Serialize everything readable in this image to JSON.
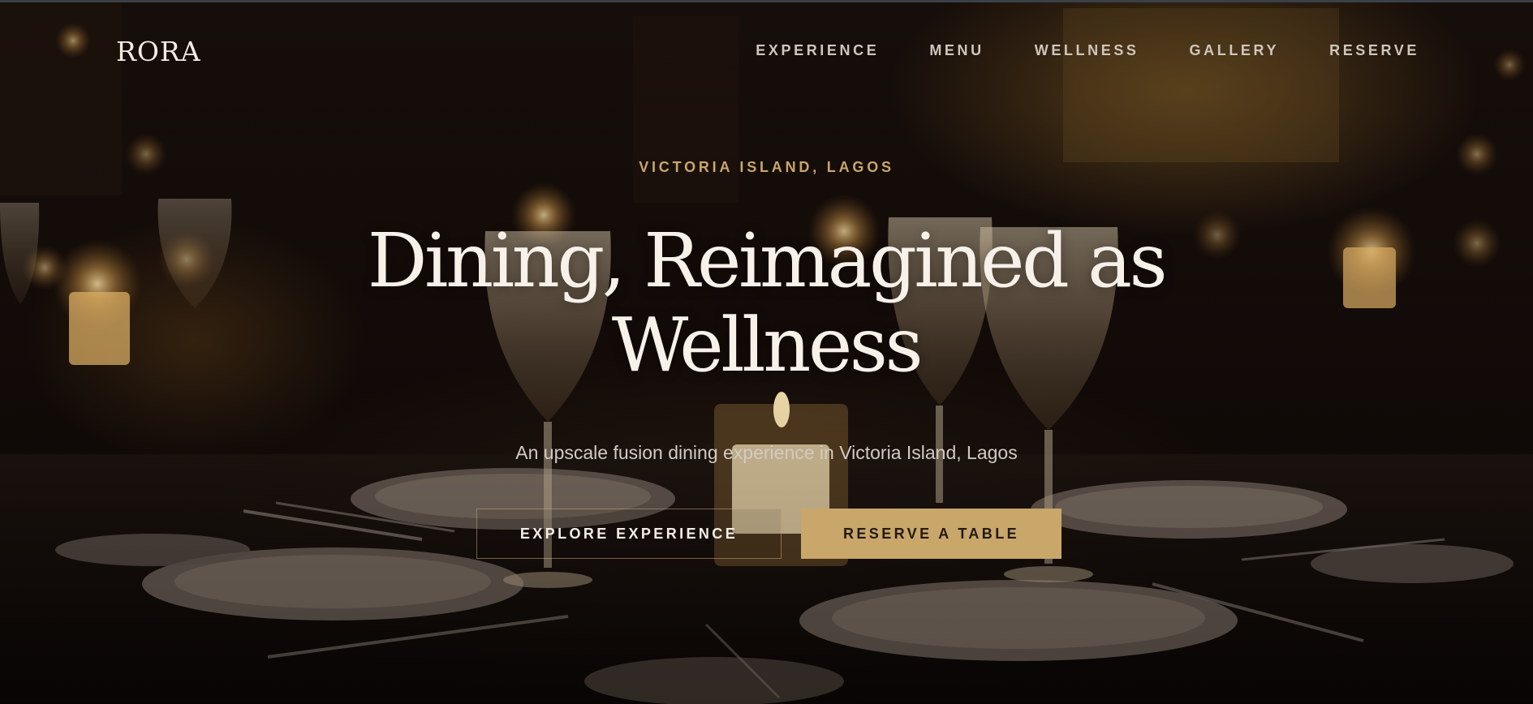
{
  "brand": {
    "logo": "RORA"
  },
  "nav": {
    "items": [
      {
        "label": "EXPERIENCE"
      },
      {
        "label": "MENU"
      },
      {
        "label": "WELLNESS"
      },
      {
        "label": "GALLERY"
      },
      {
        "label": "RESERVE"
      }
    ]
  },
  "hero": {
    "eyebrow": "VICTORIA ISLAND, LAGOS",
    "headline": "Dining, Reimagined as Wellness",
    "subtitle": "An upscale fusion dining experience in Victoria Island, Lagos",
    "primary_cta": "EXPLORE EXPERIENCE",
    "secondary_cta": "RESERVE A TABLE"
  },
  "colors": {
    "accent_gold": "#c9a669",
    "text_light": "#f7f1ea",
    "background_dark": "#120b08"
  }
}
